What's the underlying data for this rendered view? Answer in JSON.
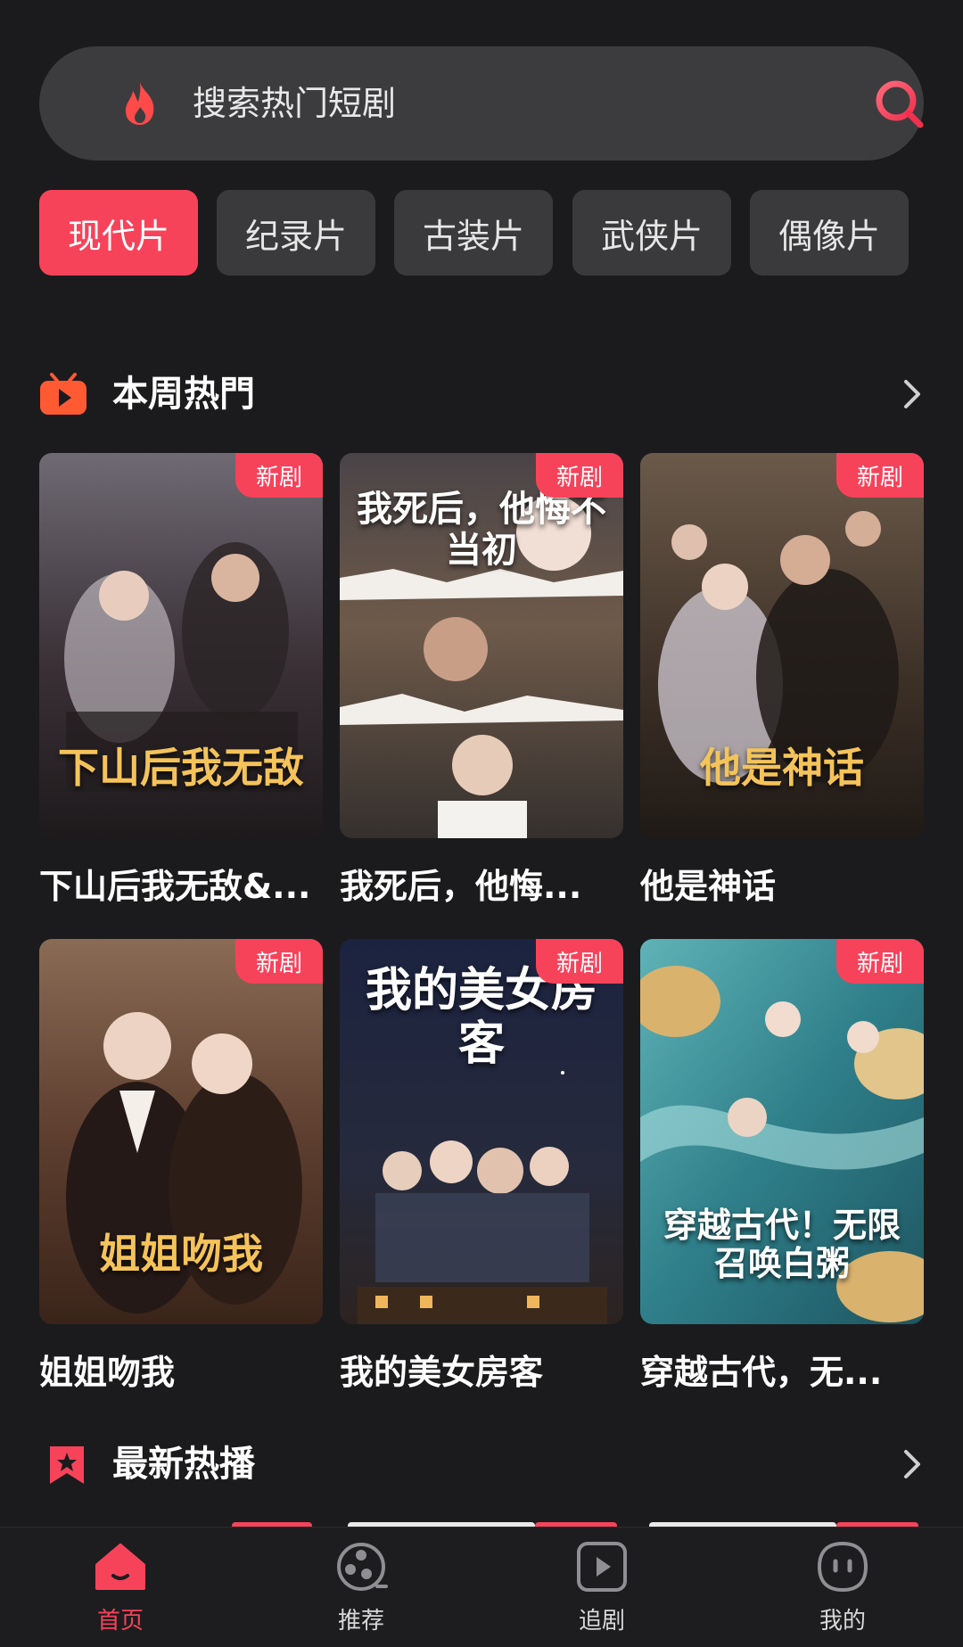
{
  "search": {
    "placeholder": "搜索热门短剧",
    "fire_icon": "fire-icon",
    "search_icon": "search-icon"
  },
  "categories": [
    {
      "label": "现代片",
      "active": true
    },
    {
      "label": "纪录片",
      "active": false
    },
    {
      "label": "古装片",
      "active": false
    },
    {
      "label": "武侠片",
      "active": false
    },
    {
      "label": "偶像片",
      "active": false
    }
  ],
  "sections": [
    {
      "title": "本周热門",
      "icon": "tv-play-icon",
      "items": [
        {
          "name": "下山后我无敌&...",
          "badge": "新剧",
          "poster_text": "下山后我无敌"
        },
        {
          "name": "我死后，他悔...",
          "badge": "新剧",
          "poster_text": "我死后，他悔不当初"
        },
        {
          "name": "他是神话",
          "badge": "新剧",
          "poster_text": "他是神话"
        },
        {
          "name": "姐姐吻我",
          "badge": "新剧",
          "poster_text": "姐姐吻我"
        },
        {
          "name": "我的美女房客",
          "badge": "新剧",
          "poster_text": "我的美女房客"
        },
        {
          "name": "穿越古代，无...",
          "badge": "新剧",
          "poster_text": "穿越古代！无限召唤白粥"
        }
      ]
    },
    {
      "title": "最新热播",
      "icon": "bookmark-star-icon",
      "items": []
    }
  ],
  "tabbar": [
    {
      "label": "首页",
      "icon": "home-icon",
      "active": true
    },
    {
      "label": "推荐",
      "icon": "film-reel-icon",
      "active": false
    },
    {
      "label": "追剧",
      "icon": "play-square-icon",
      "active": false
    },
    {
      "label": "我的",
      "icon": "smile-face-icon",
      "active": false
    }
  ],
  "colors": {
    "accent": "#f7435a",
    "background": "#1b1b1d",
    "chip": "#3a3a3c",
    "search_bg": "#3c3c3e",
    "icon_orange": "#ff5a32"
  }
}
